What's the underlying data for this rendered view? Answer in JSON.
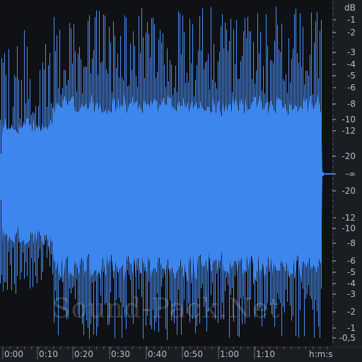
{
  "db_ruler": {
    "unit": "dB",
    "top_labels": [
      "-1",
      "-2",
      "-3",
      "-4",
      "-5",
      "-6",
      "-8",
      "-10",
      "-12",
      "-20"
    ],
    "center_label": "-∞",
    "bottom_labels": [
      "-20",
      "-12",
      "-10",
      "-8",
      "-6",
      "-5",
      "-4",
      "-3",
      "-2",
      "-1",
      "-0,5"
    ]
  },
  "time_ruler": {
    "labels": [
      "0:00",
      "0:10",
      "0:20",
      "0:30",
      "0:40",
      "0:50",
      "1:00",
      "1:10"
    ],
    "unit_label": "h:m:s"
  },
  "watermark": "Sound-Pack.Net",
  "colors": {
    "waveform_fill": "#3d86ee",
    "waveform_peaks": "#4a8ef5",
    "background": "#0f1115",
    "ruler_bg": "#1a1d22",
    "ruler_text": "#b9bec6"
  }
}
